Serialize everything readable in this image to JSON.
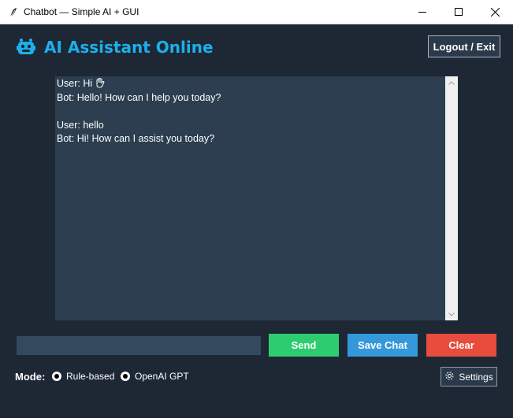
{
  "window": {
    "title": "Chatbot — Simple AI + GUI"
  },
  "header": {
    "title": "AI Assistant Online",
    "logout_label": "Logout / Exit"
  },
  "chat": {
    "lines": [
      "User: Hi",
      "Bot: Hello! How can I help you today?",
      "",
      "User: hello",
      "Bot: Hi! How can I assist you today?"
    ]
  },
  "input": {
    "value": "",
    "placeholder": ""
  },
  "buttons": {
    "send": "Send",
    "save_chat": "Save Chat",
    "clear": "Clear",
    "settings": "Settings"
  },
  "mode": {
    "label": "Mode:",
    "options": [
      "Rule-based",
      "OpenAI GPT"
    ]
  },
  "colors": {
    "background": "#1e2835",
    "accent": "#1cb0ea",
    "chat_bg": "#2c3e50",
    "send": "#2ecc71",
    "save_chat": "#3498db",
    "clear": "#e74c3c"
  },
  "icons": {
    "app": "feather-icon",
    "header": "robot-icon",
    "waving_hand": "waving-hand-icon",
    "settings": "gear-icon"
  }
}
